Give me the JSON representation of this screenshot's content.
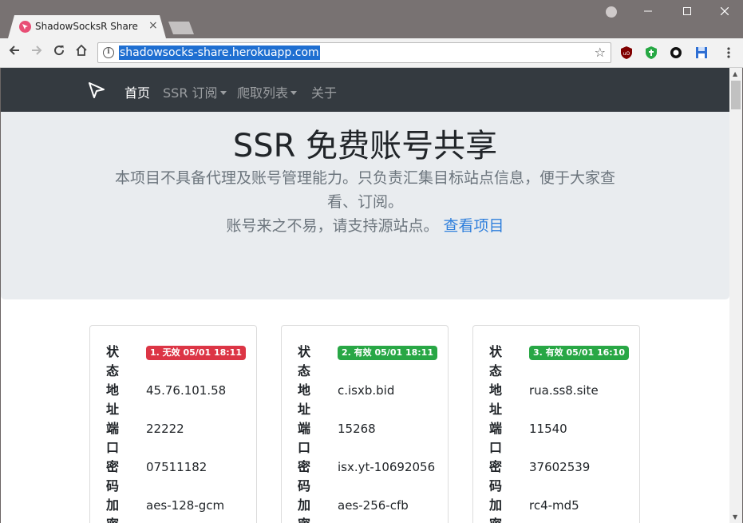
{
  "browser": {
    "tab_title": "ShadowSocksR Share",
    "url": "shadowsocks-share.herokuapp.com"
  },
  "navbar": {
    "items": [
      {
        "label": "首页"
      },
      {
        "label": "SSR 订阅"
      },
      {
        "label": "爬取列表"
      },
      {
        "label": "关于"
      }
    ]
  },
  "hero": {
    "title": "SSR 免费账号共享",
    "line1": "本项目不具备代理及账号管理能力。只负责汇集目标站点信息，便于大家查",
    "line2": "看、订阅。",
    "line3": "账号来之不易，请支持源站点。",
    "link": "查看项目"
  },
  "cards": [
    {
      "badge": "1. 无效  05/01 18:11",
      "rows": [
        {
          "label": "状态",
          "value": ""
        },
        {
          "label": "地址",
          "value": "45.76.101.58"
        },
        {
          "label": "端口",
          "value": "22222"
        },
        {
          "label": "密码",
          "value": "07511182"
        },
        {
          "label": "加密",
          "value": "aes-128-gcm"
        }
      ]
    },
    {
      "badge": "2. 有效  05/01 18:11",
      "rows": [
        {
          "label": "状态",
          "value": ""
        },
        {
          "label": "地址",
          "value": "c.isxb.bid"
        },
        {
          "label": "端口",
          "value": "15268"
        },
        {
          "label": "密码",
          "value": "isx.yt-10692056"
        },
        {
          "label": "加密",
          "value": "aes-256-cfb"
        }
      ]
    },
    {
      "badge": "3. 有效  05/01 16:10",
      "rows": [
        {
          "label": "状态",
          "value": ""
        },
        {
          "label": "地址",
          "value": "rua.ss8.site"
        },
        {
          "label": "端口",
          "value": "11540"
        },
        {
          "label": "密码",
          "value": "37602539"
        },
        {
          "label": "加密",
          "value": "rc4-md5"
        }
      ]
    }
  ],
  "colors": {
    "navbar_bg": "#343a40",
    "jumbotron_bg": "#e9ecef",
    "badge_invalid": "#dc3545",
    "badge_valid": "#28a745",
    "link": "#2f7fdc"
  }
}
